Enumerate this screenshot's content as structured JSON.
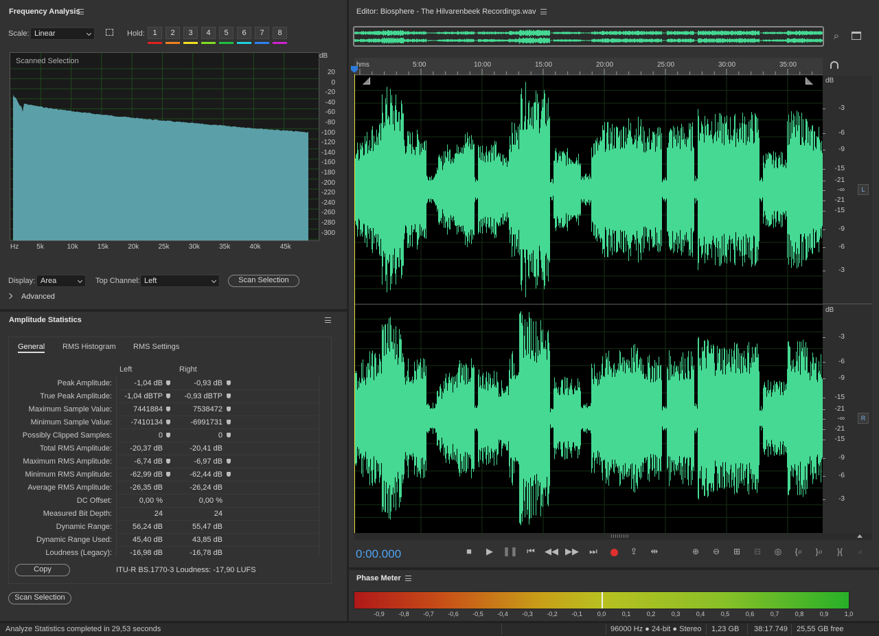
{
  "frequency_analysis": {
    "title": "Frequency Analysis",
    "scale_label": "Scale:",
    "scale_value": "Linear",
    "hold_label": "Hold:",
    "holds": [
      {
        "label": "1",
        "color": "#e02020"
      },
      {
        "label": "2",
        "color": "#f08020"
      },
      {
        "label": "3",
        "color": "#f0e020"
      },
      {
        "label": "4",
        "color": "#80e020"
      },
      {
        "label": "5",
        "color": "#20c040"
      },
      {
        "label": "6",
        "color": "#20d0e0"
      },
      {
        "label": "7",
        "color": "#3080f0"
      },
      {
        "label": "8",
        "color": "#d020d0"
      }
    ],
    "graph_caption": "Scanned Selection",
    "db_unit": "dB",
    "db_ticks": [
      "20",
      "0",
      "-20",
      "-40",
      "-60",
      "-80",
      "-100",
      "-120",
      "-140",
      "-160",
      "-180",
      "-200",
      "-220",
      "-240",
      "-260",
      "-280",
      "-300"
    ],
    "hz_ticks": [
      "Hz",
      "5k",
      "10k",
      "15k",
      "20k",
      "25k",
      "30k",
      "35k",
      "40k",
      "45k"
    ],
    "fill_color": "#5fa7b0",
    "display_label": "Display:",
    "display_value": "Area",
    "top_channel_label": "Top Channel:",
    "top_channel_value": "Left",
    "scan_button": "Scan Selection",
    "advanced_label": "Advanced"
  },
  "amplitude_statistics": {
    "title": "Amplitude Statistics",
    "tabs": [
      "General",
      "RMS Histogram",
      "RMS Settings"
    ],
    "col_left": "Left",
    "col_right": "Right",
    "rows": [
      {
        "name": "Peak Amplitude:",
        "left": "-1,04 dB",
        "right": "-0,93 dB",
        "marker_left": true,
        "marker_right": true
      },
      {
        "name": "True Peak Amplitude:",
        "left": "-1,04 dBTP",
        "right": "-0,93 dBTP",
        "marker_left": true,
        "marker_right": true
      },
      {
        "name": "Maximum Sample Value:",
        "left": "7441884",
        "right": "7538472",
        "marker_left": true,
        "marker_right": true
      },
      {
        "name": "Minimum Sample Value:",
        "left": "-7410134",
        "right": "-6991731",
        "marker_left": true,
        "marker_right": true
      },
      {
        "name": "Possibly Clipped Samples:",
        "left": "0",
        "right": "0",
        "marker_left": true,
        "marker_right": true
      },
      {
        "name": "Total RMS Amplitude:",
        "left": "-20,37 dB",
        "right": "-20,41 dB",
        "marker_left": false,
        "marker_right": false
      },
      {
        "name": "Maximum RMS Amplitude:",
        "left": "-6,74 dB",
        "right": "-6,97 dB",
        "marker_left": true,
        "marker_right": true
      },
      {
        "name": "Minimum RMS Amplitude:",
        "left": "-62,99 dB",
        "right": "-62,44 dB",
        "marker_left": true,
        "marker_right": true
      },
      {
        "name": "Average RMS Amplitude:",
        "left": "-26,35 dB",
        "right": "-26,24 dB",
        "marker_left": false,
        "marker_right": false
      },
      {
        "name": "DC Offset:",
        "left": "0,00 %",
        "right": "0,00 %",
        "marker_left": false,
        "marker_right": false
      },
      {
        "name": "Measured Bit Depth:",
        "left": "24",
        "right": "24",
        "marker_left": false,
        "marker_right": false
      },
      {
        "name": "Dynamic Range:",
        "left": "56,24 dB",
        "right": "55,47 dB",
        "marker_left": false,
        "marker_right": false
      },
      {
        "name": "Dynamic Range Used:",
        "left": "45,40 dB",
        "right": "43,85 dB",
        "marker_left": false,
        "marker_right": false
      },
      {
        "name": "Loudness (Legacy):",
        "left": "-16,98 dB",
        "right": "-16,78 dB",
        "marker_left": false,
        "marker_right": false
      }
    ],
    "copy_button": "Copy",
    "loudness_text": "ITU-R BS.1770-3 Loudness:  -17,90 LUFS",
    "scan_button": "Scan Selection"
  },
  "editor": {
    "title": "Editor: Biosphere - The Hilvarenbeek Recordings.wav",
    "ruler_unit": "hms",
    "time_ticks": [
      "5:00",
      "10:00",
      "15:00",
      "20:00",
      "25:00",
      "30:00",
      "35:00"
    ],
    "db_unit": "dB",
    "db_ticks": [
      "-3",
      "-6",
      "-9",
      "-15",
      "-21",
      "-∞",
      "-21",
      "-15",
      "-9",
      "-6",
      "-3"
    ],
    "channel_left": "L",
    "channel_right": "R",
    "wave_color": "#45d993",
    "current_time": "0:00.000"
  },
  "phase_meter": {
    "title": "Phase Meter",
    "ticks": [
      "-0,9",
      "-0,8",
      "-0,7",
      "-0,6",
      "-0,5",
      "-0,4",
      "-0,3",
      "-0,2",
      "-0,1",
      "0,0",
      "0,1",
      "0,2",
      "0,3",
      "0,4",
      "0,5",
      "0,6",
      "0,7",
      "0,8",
      "0,9",
      "1,0"
    ]
  },
  "status_bar": {
    "message": "Analyze Statistics completed in 29,53 seconds",
    "format": "96000 Hz ● 24-bit ● Stereo",
    "size": "1,23 GB",
    "duration": "38:17.749",
    "free": "25,55 GB free"
  }
}
